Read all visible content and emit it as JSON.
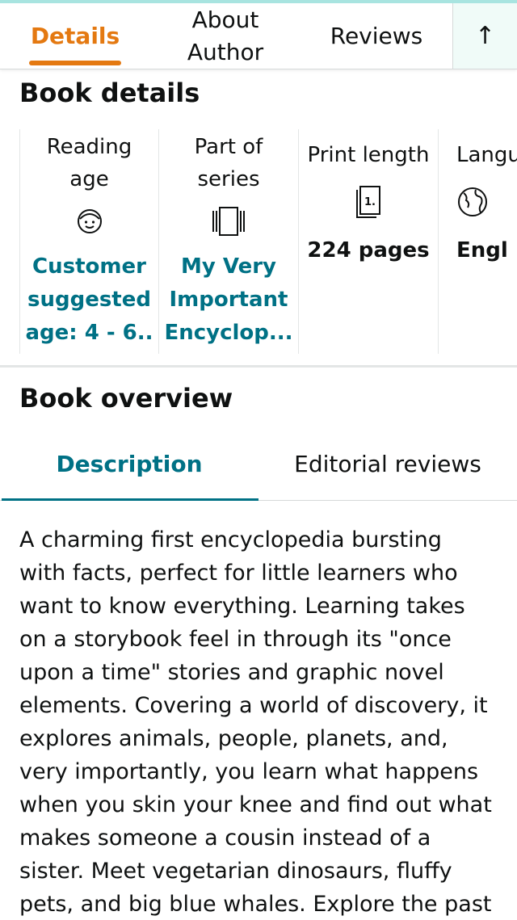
{
  "nav": {
    "tabs": [
      {
        "label": "Details"
      },
      {
        "label_line1": "About",
        "label_line2": "Author"
      },
      {
        "label": "Reviews"
      }
    ],
    "up_arrow": "↑",
    "active_color": "#e47911"
  },
  "book_details": {
    "title": "Book details",
    "items": [
      {
        "label_line1": "Reading",
        "label_line2": "age",
        "icon": "child-face-icon",
        "value_lines": [
          "Customer",
          "suggested",
          "age: 4 - 6.."
        ]
      },
      {
        "label_line1": "Part of",
        "label_line2": "series",
        "icon": "book-series-icon",
        "value_lines": [
          "My Very",
          "Important",
          "Encyclop..."
        ]
      },
      {
        "label": "Print length",
        "icon": "pages-icon",
        "icon_text": "1.",
        "value": "224 pages"
      },
      {
        "label": "Langu",
        "icon": "globe-icon",
        "value": "Engl"
      }
    ],
    "link_color": "#007185"
  },
  "book_overview": {
    "title": "Book overview",
    "tabs": [
      {
        "label": "Description",
        "active": true
      },
      {
        "label": "Editorial reviews",
        "active": false
      }
    ]
  },
  "description": {
    "lines": [
      "A charming first encyclopedia bursting",
      "with facts, perfect for little learners who",
      "want to know everything. Learning takes",
      "on a storybook feel in through its \"once",
      "upon a time\" stories and graphic novel",
      "elements. Covering a world of discovery, it",
      "explores animals, people, planets, and,",
      "very importantly, you learn what happens",
      "when you skin your knee and find out what",
      "makes someone a cousin instead of a",
      "sister. Meet vegetarian dinosaurs, fluffy",
      "pets, and big blue whales. Explore the past"
    ]
  }
}
